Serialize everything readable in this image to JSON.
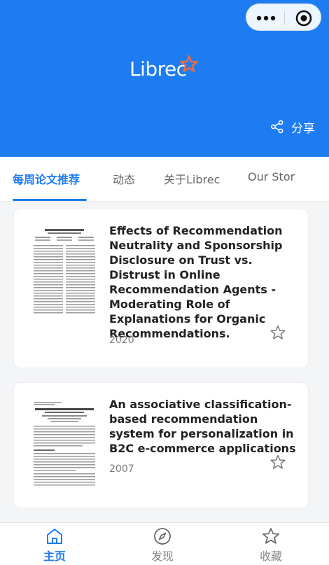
{
  "header": {
    "logo_text": "Librec",
    "share_label": "分享",
    "bg_color": "#1e7cf2"
  },
  "tabs": [
    {
      "label": "每周论文推荐",
      "active": true
    },
    {
      "label": "动态",
      "active": false
    },
    {
      "label": "关于Librec",
      "active": false
    },
    {
      "label": "Our Stor",
      "active": false
    }
  ],
  "papers": [
    {
      "title": "Effects of Recommendation Neutrality and Sponsorship Disclosure on Trust vs. Distrust in Online Recommendation Agents - Moderating Role of Explanations for Organic Recommendations.",
      "year": "2020",
      "thumbnail_icon": "paper-thumbnail-icon",
      "favorite_icon": "star-outline-icon"
    },
    {
      "title": "An associative classification-based recommendation system for personalization in B2C e-commerce applications",
      "year": "2007",
      "thumbnail_icon": "paper-thumbnail-icon",
      "favorite_icon": "star-outline-icon"
    }
  ],
  "bottom_nav": [
    {
      "label": "主页",
      "icon": "home-icon",
      "active": true
    },
    {
      "label": "发现",
      "icon": "compass-icon",
      "active": false
    },
    {
      "label": "收藏",
      "icon": "star-icon",
      "active": false
    }
  ],
  "colors": {
    "accent": "#1e7cf2",
    "star_orange": "#f26b3a"
  }
}
